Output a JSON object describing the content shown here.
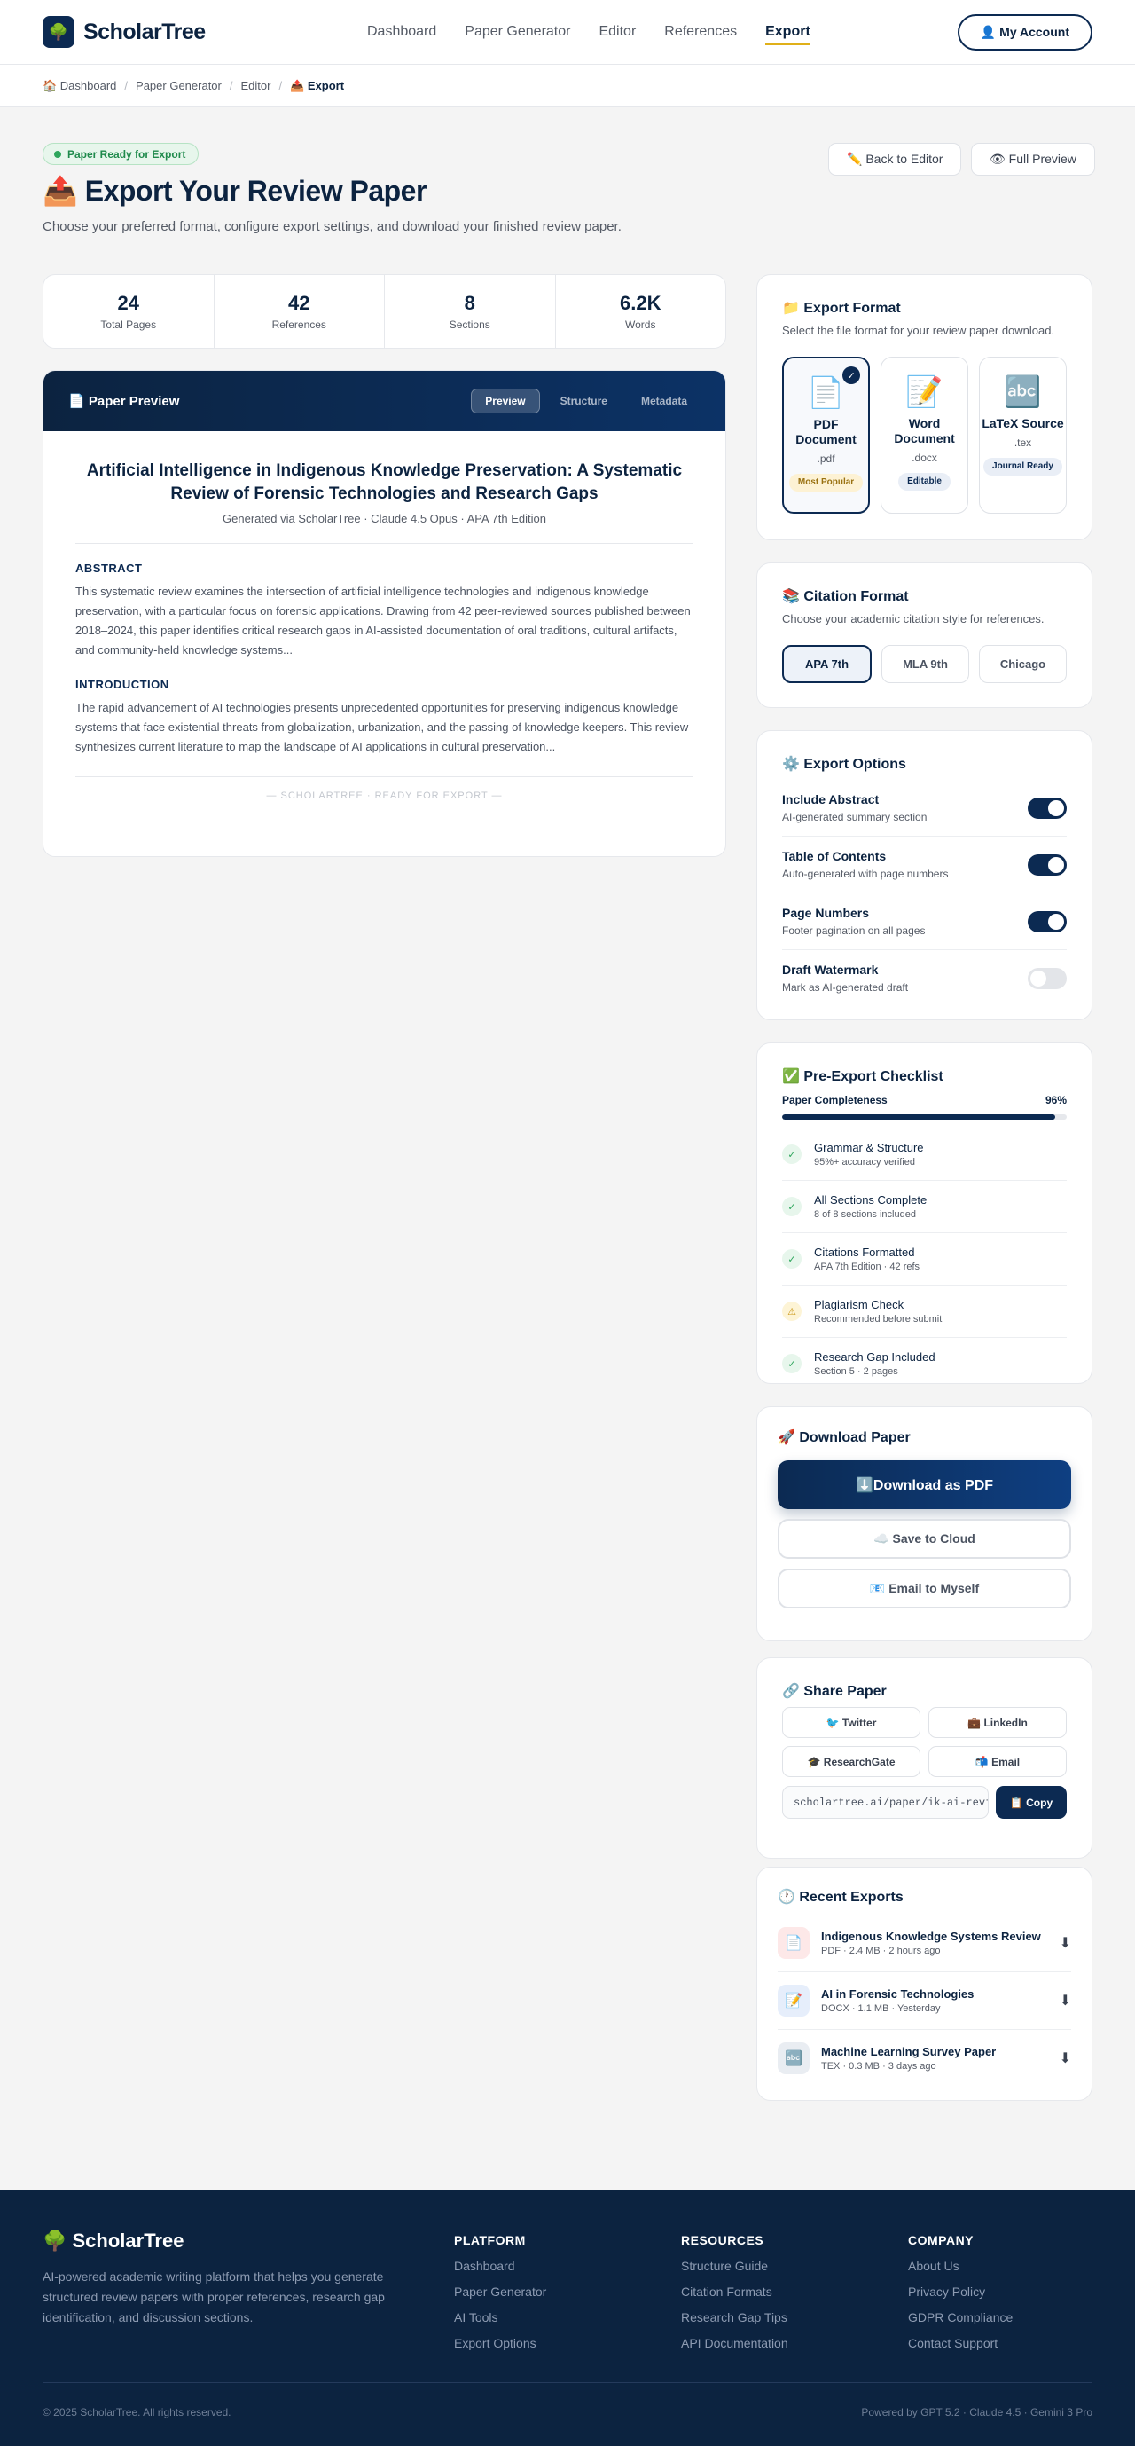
{
  "brand": {
    "name": "ScholarTree",
    "logo_icon": "🌳"
  },
  "nav": {
    "items": [
      "Dashboard",
      "Paper Generator",
      "Editor",
      "References",
      "Export"
    ],
    "active": "Export"
  },
  "account_button": "👤 My Account",
  "breadcrumb": [
    {
      "label": "🏠 Dashboard"
    },
    {
      "label": "Paper Generator"
    },
    {
      "label": "Editor"
    },
    {
      "label": "📤 Export"
    }
  ],
  "hero": {
    "badge": "Paper Ready for Export",
    "title": "📤 Export Your Review Paper",
    "subtitle": "Choose your preferred format, configure export settings, and download your finished review paper.",
    "back_button": "✏️ Back to Editor",
    "preview_button": "👁 Full Preview"
  },
  "stats": [
    {
      "value": "24",
      "label": "Total Pages"
    },
    {
      "value": "42",
      "label": "References"
    },
    {
      "value": "8",
      "label": "Sections"
    },
    {
      "value": "6.2K",
      "label": "Words"
    }
  ],
  "preview": {
    "header": "📄 Paper Preview",
    "tabs": [
      "Preview",
      "Structure",
      "Metadata"
    ],
    "active_tab": "Preview",
    "title": "Artificial Intelligence in Indigenous Knowledge Preservation: A Systematic Review of Forensic Technologies and Research Gaps",
    "meta": "Generated via ScholarTree · Claude 4.5 Opus · APA 7th Edition",
    "abstract_heading": "ABSTRACT",
    "abstract": "This systematic review examines the intersection of artificial intelligence technologies and indigenous knowledge preservation, with a particular focus on forensic applications. Drawing from 42 peer-reviewed sources published between 2018–2024, this paper identifies critical research gaps in AI-assisted documentation of oral traditions, cultural artifacts, and community-held knowledge systems...",
    "intro_heading": "INTRODUCTION",
    "intro": "The rapid advancement of AI technologies presents unprecedented opportunities for preserving indigenous knowledge systems that face existential threats from globalization, urbanization, and the passing of knowledge keepers. This review synthesizes current literature to map the landscape of AI applications in cultural preservation...",
    "footer": "— SCHOLARTREE · READY FOR EXPORT —"
  },
  "export_format": {
    "title": "📁 Export Format",
    "subtitle": "Select the file format for your review paper download.",
    "options": [
      {
        "icon": "📄",
        "name": "PDF Document",
        "ext": ".pdf",
        "tag": "Most Popular",
        "selected": true
      },
      {
        "icon": "📝",
        "name": "Word Document",
        "ext": ".docx",
        "tag": "Editable",
        "selected": false
      },
      {
        "icon": "🔤",
        "name": "LaTeX Source",
        "ext": ".tex",
        "tag": "Journal Ready",
        "selected": false
      }
    ],
    "check": "✓"
  },
  "citation_format": {
    "title": "📚 Citation Format",
    "subtitle": "Choose your academic citation style for references.",
    "options": [
      "APA 7th",
      "MLA 9th",
      "Chicago"
    ],
    "selected": "APA 7th"
  },
  "export_options": {
    "title": "⚙️ Export Options",
    "items": [
      {
        "name": "Include Abstract",
        "desc": "AI-generated summary section",
        "on": true
      },
      {
        "name": "Table of Contents",
        "desc": "Auto-generated with page numbers",
        "on": true
      },
      {
        "name": "Page Numbers",
        "desc": "Footer pagination on all pages",
        "on": true
      },
      {
        "name": "Draft Watermark",
        "desc": "Mark as AI-generated draft",
        "on": false
      }
    ]
  },
  "checklist": {
    "title": "✅ Pre-Export Checklist",
    "progress_label": "Paper Completeness",
    "progress_text": "96%",
    "progress": 0.96,
    "items": [
      {
        "status": "ok",
        "icon": "✓",
        "name": "Grammar & Structure",
        "desc": "95%+ accuracy verified"
      },
      {
        "status": "ok",
        "icon": "✓",
        "name": "All Sections Complete",
        "desc": "8 of 8 sections included"
      },
      {
        "status": "ok",
        "icon": "✓",
        "name": "Citations Formatted",
        "desc": "APA 7th Edition · 42 refs"
      },
      {
        "status": "warn",
        "icon": "⚠",
        "name": "Plagiarism Check",
        "desc": "Recommended before submit"
      },
      {
        "status": "ok",
        "icon": "✓",
        "name": "Research Gap Included",
        "desc": "Section 5 · 2 pages"
      }
    ]
  },
  "download": {
    "title": "🚀 Download Paper",
    "primary": "⬇️Download as PDF",
    "cloud": "☁️ Save to Cloud",
    "email": "📧 Email to Myself"
  },
  "share": {
    "title": "🔗 Share Paper",
    "buttons": [
      "🐦 Twitter",
      "💼 LinkedIn",
      "🎓 ResearchGate",
      "📬 Email"
    ],
    "link": "scholartree.ai/paper/ik-ai-review",
    "copy": "📋 Copy"
  },
  "recent": {
    "title": "🕐 Recent Exports",
    "items": [
      {
        "icon": "📄",
        "name": "Indigenous Knowledge Systems Review",
        "meta": "PDF · 2.4 MB · 2 hours ago",
        "bg": "#fde8e8"
      },
      {
        "icon": "📝",
        "name": "AI in Forensic Technologies",
        "meta": "DOCX · 1.1 MB · Yesterday",
        "bg": "#e6eefb"
      },
      {
        "icon": "🔤",
        "name": "Machine Learning Survey Paper",
        "meta": "TEX · 0.3 MB · 3 days ago",
        "bg": "#e9edf2"
      }
    ],
    "download_icon": "⬇"
  },
  "footer": {
    "brand": "🌳 ScholarTree",
    "description": "AI-powered academic writing platform that helps you generate structured review papers with proper references, research gap identification, and discussion sections.",
    "columns": [
      {
        "title": "PLATFORM",
        "links": [
          "Dashboard",
          "Paper Generator",
          "AI Tools",
          "Export Options"
        ]
      },
      {
        "title": "RESOURCES",
        "links": [
          "Structure Guide",
          "Citation Formats",
          "Research Gap Tips",
          "API Documentation"
        ]
      },
      {
        "title": "COMPANY",
        "links": [
          "About Us",
          "Privacy Policy",
          "GDPR Compliance",
          "Contact Support"
        ]
      }
    ],
    "copyright": "© 2025 ScholarTree. All rights reserved.",
    "powered": "Powered by GPT 5.2 · Claude 4.5 · Gemini 3 Pro"
  },
  "colors": {
    "primary": "#0c2a52",
    "accent": "#e0b019",
    "success": "#2ea65c",
    "warning": "#c99412"
  }
}
